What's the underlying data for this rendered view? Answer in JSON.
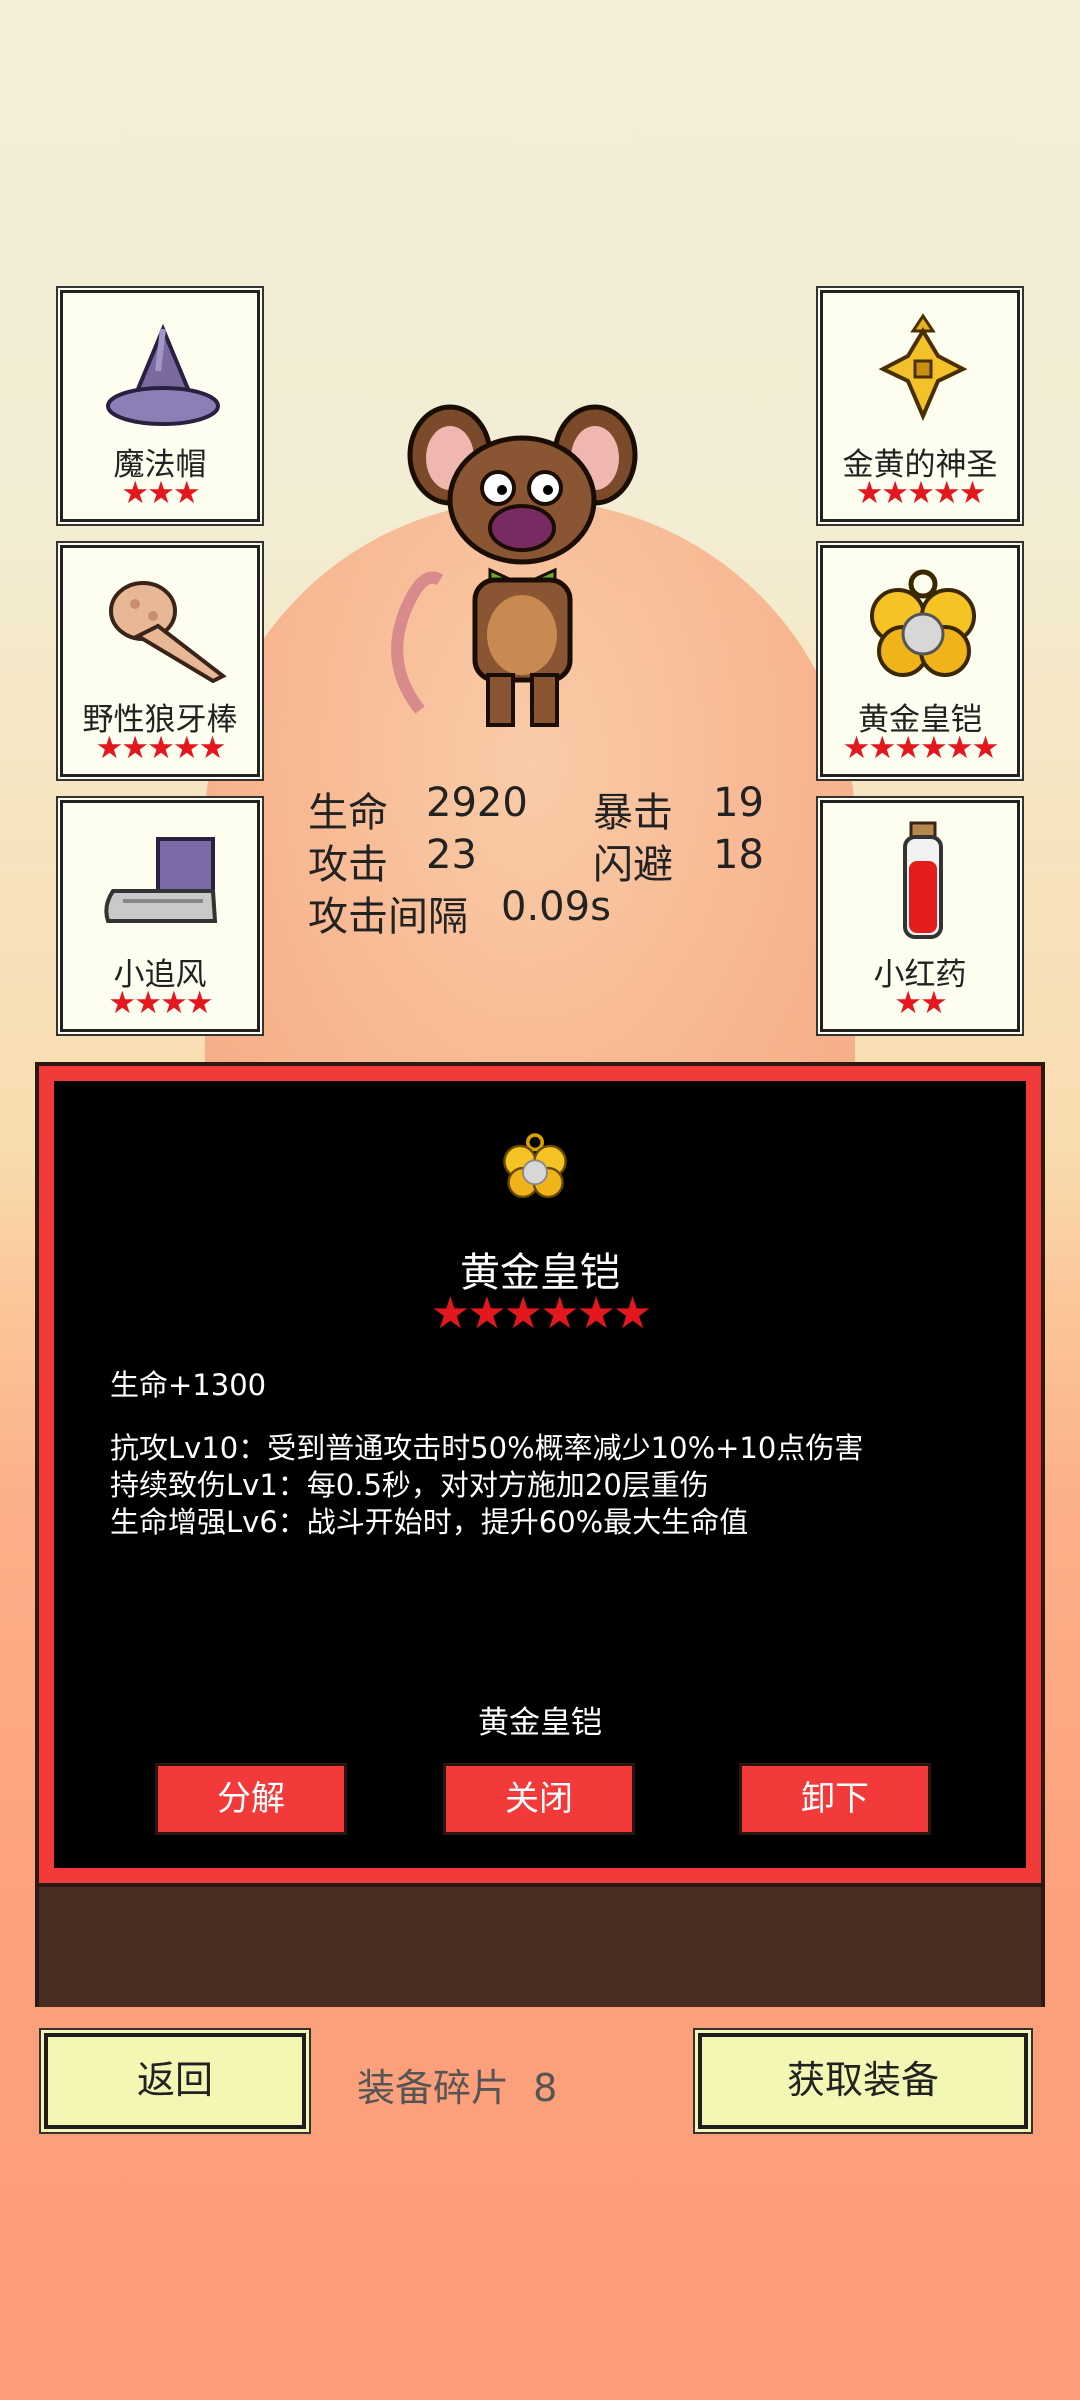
{
  "equipment_left": [
    {
      "name": "魔法帽",
      "stars": "★★★",
      "icon": "wizard-hat-icon"
    },
    {
      "name": "野性狼牙棒",
      "stars": "★★★★★",
      "icon": "wolf-fang-club-icon"
    },
    {
      "name": "小追风",
      "stars": "★★★★",
      "icon": "boot-icon"
    }
  ],
  "equipment_right": [
    {
      "name": "金黄的神圣",
      "stars": "★★★★★",
      "icon": "golden-cross-amulet-icon"
    },
    {
      "name": "黄金皇铠",
      "stars": "★★★★★★",
      "icon": "golden-armor-icon"
    },
    {
      "name": "小红药",
      "stars": "★★",
      "icon": "red-potion-icon"
    }
  ],
  "character": {
    "icon": "rat-character-sprite"
  },
  "stats": {
    "hp_label": "生命",
    "hp_value": "2920",
    "crit_label": "暴击",
    "crit_value": "19",
    "atk_label": "攻击",
    "atk_value": "23",
    "dodge_label": "闪避",
    "dodge_value": "18",
    "interval_label": "攻击间隔",
    "interval_value": "0.09s"
  },
  "detail": {
    "icon": "golden-armor-icon",
    "title": "黄金皇铠",
    "stars": "★★★★★★",
    "base_stat": "生命+1300",
    "lines": [
      "抗攻Lv10：受到普通攻击时50%概率减少10%+10点伤害",
      "持续致伤Lv1：每0.5秒，对对方施加20层重伤",
      "生命增强Lv6：战斗开始时，提升60%最大生命值"
    ],
    "subtitle": "黄金皇铠",
    "buttons": {
      "decompose": "分解",
      "close": "关闭",
      "unequip": "卸下"
    }
  },
  "footer": {
    "back": "返回",
    "fragments_label": "装备碎片",
    "fragments_count": "8",
    "get_equipment": "获取装备"
  },
  "colors": {
    "accent_red": "#f23a3a",
    "star_red": "#e4171f",
    "button_cream": "#f4f7b3",
    "panel_black": "#000000"
  }
}
